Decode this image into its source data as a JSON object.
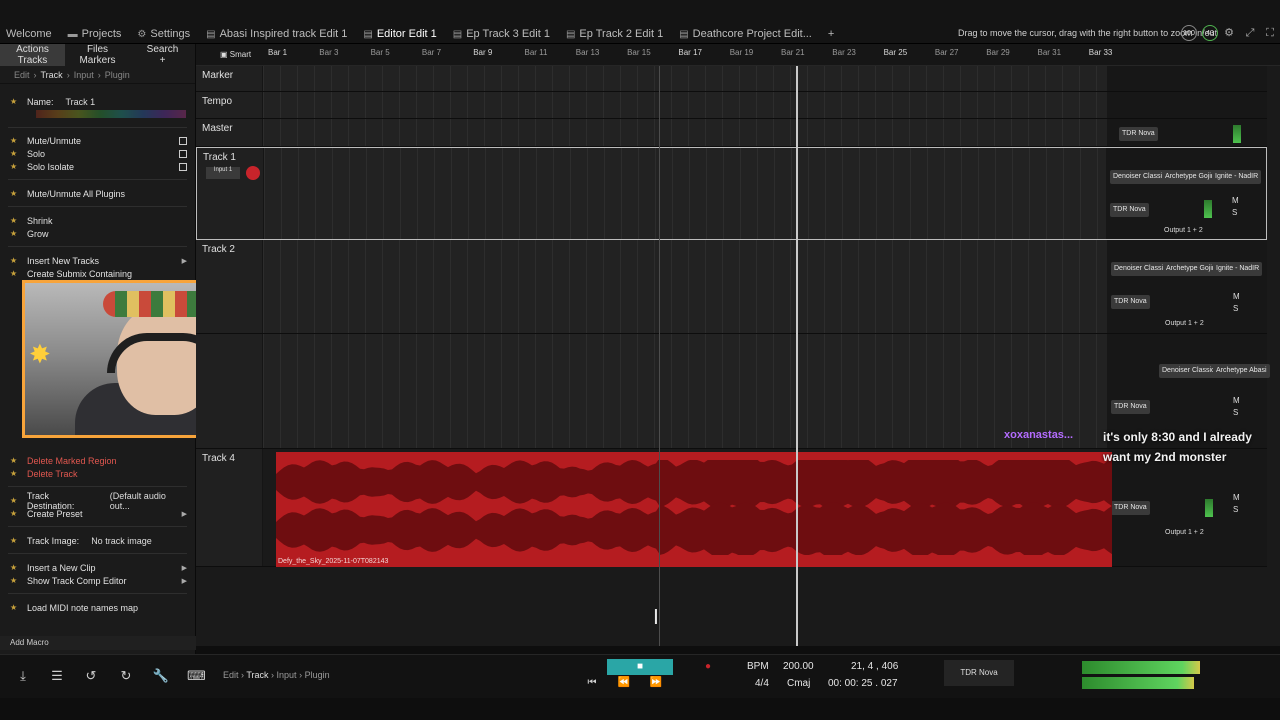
{
  "window": {
    "tabs": [
      {
        "label": "Welcome",
        "icon": "none"
      },
      {
        "label": "Projects",
        "icon": "folder-icon"
      },
      {
        "label": "Settings",
        "icon": "gear-icon"
      },
      {
        "label": "Abasi Inspired track Edit 1",
        "icon": "edit-icon"
      },
      {
        "label": "Editor Edit 1",
        "icon": "edit-icon"
      },
      {
        "label": "Ep Track 3 Edit 1",
        "icon": "edit-icon"
      },
      {
        "label": "Ep Track 2 Edit 1",
        "icon": "edit-icon"
      },
      {
        "label": "Deathcore Project Edit...",
        "icon": "edit-icon"
      }
    ],
    "active_tab": "Editor Edit 1",
    "add_tab": "+",
    "hint": "Drag to move the cursor, drag with the right button to zoom in/out",
    "cpu_a": "100",
    "cpu_b": "43"
  },
  "left_panel": {
    "tabs": [
      [
        "Actions",
        "Tracks"
      ],
      [
        "Files",
        "Markers"
      ],
      [
        "Search",
        "+"
      ]
    ],
    "breadcrumb": [
      "Edit",
      "Track",
      "Input",
      "Plugin"
    ],
    "name_label": "Name:",
    "name_value": "Track 1",
    "items": [
      {
        "label": "Mute/Unmute",
        "kind": "check"
      },
      {
        "label": "Solo",
        "kind": "check"
      },
      {
        "label": "Solo Isolate",
        "kind": "check"
      },
      {
        "label": "Mute/Unmute All Plugins",
        "kind": "plain"
      },
      {
        "label": "Shrink",
        "kind": "plain"
      },
      {
        "label": "Grow",
        "kind": "plain"
      },
      {
        "label": "Insert New Tracks",
        "kind": "sub"
      },
      {
        "label": "Create Submix Containing",
        "kind": "plain"
      },
      {
        "label": "Delete Marked Region",
        "kind": "red"
      },
      {
        "label": "Delete Track",
        "kind": "red"
      }
    ],
    "track_destination_label": "Track Destination:",
    "track_destination_value": "(Default audio out...",
    "create_preset": "Create Preset",
    "track_image_label": "Track Image:",
    "track_image_value": "No track image",
    "insert_clip": "Insert a New Clip",
    "show_comp": "Show Track Comp Editor",
    "load_midi": "Load MIDI note names map",
    "add_macro": "Add Macro"
  },
  "ruler": {
    "mode": "Smart",
    "bars": [
      "Bar 1",
      "Bar 3",
      "Bar 5",
      "Bar 7",
      "Bar 9",
      "Bar 11",
      "Bar 13",
      "Bar 15",
      "Bar 17",
      "Bar 19",
      "Bar 21",
      "Bar 23",
      "Bar 25",
      "Bar 27",
      "Bar 29",
      "Bar 31",
      "Bar 33"
    ]
  },
  "tracks": {
    "marker": "Marker",
    "tempo": "Tempo",
    "master": "Master",
    "track1": "Track 1",
    "track1_input": "Input 1",
    "track2": "Track 2",
    "track4": "Track 4",
    "clip_name": "Defy_the_Sky_2025-11-07T082143",
    "plugins": {
      "denoiser": "Denoiser Classic",
      "archetype_gojira": "Archetype Gojira",
      "ignite": "Ignite - NadIR",
      "archetype_abasi": "Archetype Abasi",
      "tdr_nova": "TDR Nova",
      "output": "Output 1 + 2",
      "m": "M",
      "s": "S"
    }
  },
  "chat": {
    "user": "xoxanastas...",
    "message": "it's only 8:30 and I already want my 2nd monster"
  },
  "transport": {
    "breadcrumb": [
      "Edit",
      "Track",
      "Input",
      "Plugin"
    ],
    "bpm_label": "BPM",
    "bpm_value": "200.00",
    "position": "21, 4 , 406",
    "time_sig": "4/4",
    "key": "Cmaj",
    "timecode": "00: 00: 25 . 027",
    "plugin": "TDR Nova"
  },
  "colors": {
    "clip": "#b51c20",
    "play_accent": "#2aa6a6",
    "chat_user": "#b46cff",
    "webcam_border": "#f7a43b"
  }
}
